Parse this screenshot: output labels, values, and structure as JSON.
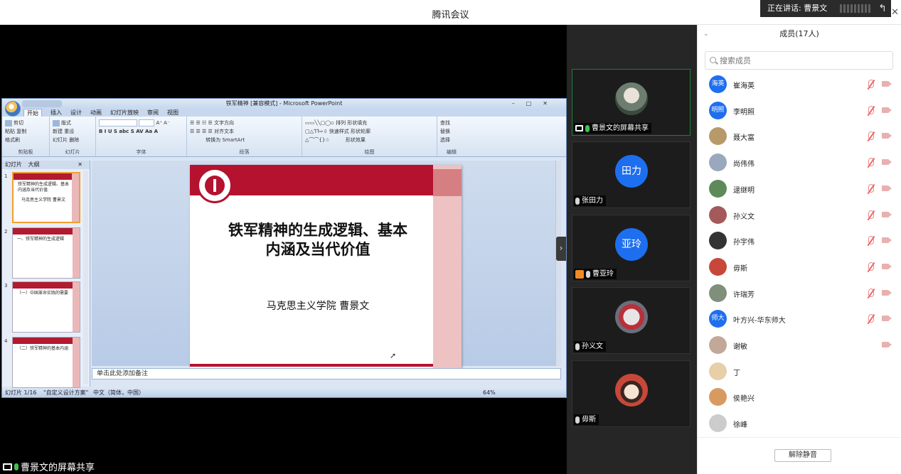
{
  "window": {
    "title": "腾讯会议",
    "speaking": "正在讲话: 曹景文"
  },
  "ppt": {
    "title": "铁军精神 [兼容模式] - Microsoft PowerPoint",
    "tabs": [
      "开始",
      "插入",
      "设计",
      "动画",
      "幻灯片放映",
      "审阅",
      "视图"
    ],
    "ribbon": {
      "clipboard": {
        "paste": "粘贴",
        "cut": "剪切",
        "copy": "复制",
        "painter": "格式刷",
        "label": "剪贴板"
      },
      "slides": {
        "new": "新建",
        "new2": "幻灯片",
        "layout": "版式",
        "reset": "重设",
        "delete": "删除",
        "label": "幻灯片"
      },
      "font": {
        "label": "字体"
      },
      "paragraph": {
        "textdir": "文字方向",
        "align": "对齐文本",
        "smartart": "转换为 SmartArt",
        "label": "段落"
      },
      "drawing": {
        "arrange": "排列",
        "quick": "快速样式",
        "fill": "形状填充",
        "outline": "形状轮廓",
        "effect": "形状效果",
        "label": "绘图"
      },
      "editing": {
        "find": "查找",
        "replace": "替换",
        "select": "选择",
        "label": "编辑"
      }
    },
    "panel_tabs": [
      "幻灯片",
      "大纲"
    ],
    "thumbs": [
      {
        "num": "1",
        "text": "铁军精神的生成逻辑、基本内涵及当代价值",
        "sub": "马克思主义学院  曹景文"
      },
      {
        "num": "2",
        "text": "一、铁军精神的生成逻辑"
      },
      {
        "num": "3",
        "text": "（一）中国革命实践的需要"
      },
      {
        "num": "4",
        "text": "（二）铁军精神的基本内涵"
      }
    ],
    "slide": {
      "title_line1": "铁军精神的生成逻辑、基本",
      "title_line2": "内涵及当代价值",
      "author": "马克思主义学院    曹景文"
    },
    "notes_placeholder": "单击此处添加备注",
    "status": {
      "slide": "幻灯片 1/16",
      "theme": "\"自定义设计方案\"",
      "lang": "中文（简体，中国）",
      "zoom": "64%"
    }
  },
  "share_label": "曹景文的屏幕共享",
  "tiles": [
    {
      "name": "曹景文的屏幕共享",
      "avatar": "",
      "color": ""
    },
    {
      "name": "张田力",
      "avatar": "田力",
      "color": "#1e6ef0"
    },
    {
      "name": "曹亚玲",
      "avatar": "亚玲",
      "color": "#1e6ef0"
    },
    {
      "name": "孙义文",
      "avatar": "",
      "color": ""
    },
    {
      "name": "毋斯",
      "avatar": "",
      "color": ""
    }
  ],
  "members_panel": {
    "title": "成员(17人)",
    "search_placeholder": "搜索成员",
    "members": [
      {
        "name": "崔海英",
        "avatar": "海英",
        "color": "#1e6ef0"
      },
      {
        "name": "李明照",
        "avatar": "明照",
        "color": "#1e6ef0"
      },
      {
        "name": "聂大富",
        "avatar": "",
        "color": "#b89a6a"
      },
      {
        "name": "尚伟伟",
        "avatar": "",
        "color": "#9aa8bd"
      },
      {
        "name": "逯继明",
        "avatar": "",
        "color": "#5e8a5a"
      },
      {
        "name": "孙义文",
        "avatar": "",
        "color": "#a45a5a"
      },
      {
        "name": "孙宇伟",
        "avatar": "",
        "color": "#333333"
      },
      {
        "name": "毋斯",
        "avatar": "",
        "color": "#c7483a"
      },
      {
        "name": "许瑞芳",
        "avatar": "",
        "color": "#7f8f7a"
      },
      {
        "name": "叶方兴-华东师大",
        "avatar": "师大",
        "color": "#1e6ef0"
      },
      {
        "name": "谢敏",
        "avatar": "",
        "color": "#c2a898"
      },
      {
        "name": "丁",
        "avatar": "",
        "color": "#e6cfa9"
      },
      {
        "name": "侯艳兴",
        "avatar": "",
        "color": "#d99a62"
      },
      {
        "name": "徐峰",
        "avatar": "",
        "color": "#cccccc"
      }
    ],
    "unmute_all": "解除静音"
  }
}
